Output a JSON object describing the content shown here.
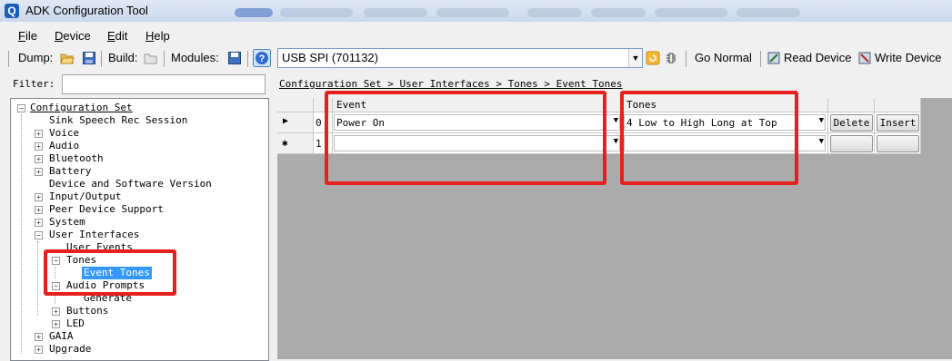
{
  "window": {
    "title": "ADK Configuration Tool",
    "icon": "Q"
  },
  "menu": [
    "File",
    "Device",
    "Edit",
    "Help"
  ],
  "toolbar": {
    "dump_label": "Dump:",
    "build_label": "Build:",
    "modules_label": "Modules:",
    "connection_value": "USB SPI (701132)",
    "go_normal": "Go Normal",
    "read_device": "Read Device",
    "write_device": "Write Device"
  },
  "filter": {
    "label": "Filter:",
    "value": ""
  },
  "breadcrumb": "Configuration Set > User Interfaces > Tones > Event Tones",
  "tree": {
    "root": "Configuration Set",
    "items": [
      "Sink Speech Rec Session",
      "Voice",
      "Audio",
      "Bluetooth",
      "Battery",
      "Device and Software Version",
      "Input/Output",
      "Peer Device Support",
      "System",
      "User Interfaces",
      "User Events",
      "Tones",
      "Event Tones",
      "Audio Prompts",
      "Generate",
      "Buttons",
      "LED",
      "GAIA",
      "Upgrade"
    ]
  },
  "grid": {
    "columns": {
      "event": "Event",
      "tones": "Tones"
    },
    "rows": [
      {
        "marker": "▶",
        "index": "0",
        "event": "Power On",
        "tones": "4 Low to High Long at Top",
        "delete": "Delete",
        "insert": "Insert"
      },
      {
        "marker": "✱",
        "index": "1",
        "event": "",
        "tones": "",
        "delete": "",
        "insert": ""
      }
    ]
  },
  "colors": {
    "highlight_red": "#e8201b",
    "selection": "#3399ff"
  }
}
